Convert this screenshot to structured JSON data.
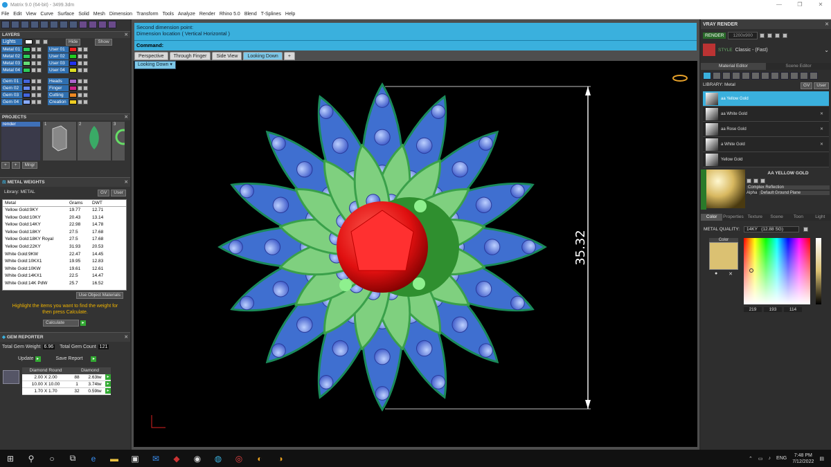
{
  "window": {
    "title": "Matrix 9.0 (64-bit) - 3499.3dm",
    "controls": [
      "—",
      "❐",
      "✕"
    ]
  },
  "menu": [
    "File",
    "Edit",
    "View",
    "Curve",
    "Surface",
    "Solid",
    "Mesh",
    "Dimension",
    "Transform",
    "Tools",
    "Analyze",
    "Render",
    "Rhino 5.0",
    "Blend",
    "T-Splines",
    "Help"
  ],
  "layers": {
    "title": "LAYERS",
    "lights": "Lights",
    "hide_label": "Hide",
    "show_label": "Show",
    "left": [
      {
        "name": "Metal 01",
        "color": "#2ecc5a"
      },
      {
        "name": "Metal 02",
        "color": "#2ecc5a"
      },
      {
        "name": "Metal 03",
        "color": "#66dd77"
      },
      {
        "name": "Metal 04",
        "color": "#2ecc5a"
      },
      {
        "name": "Gem 01",
        "color": "#4466dd"
      },
      {
        "name": "Gem 02",
        "color": "#6688ee"
      },
      {
        "name": "Gem 03",
        "color": "#4466dd"
      },
      {
        "name": "Gem 04",
        "color": "#88aaff"
      }
    ],
    "right": [
      {
        "name": "User 01",
        "color": "#ee2222"
      },
      {
        "name": "User 02",
        "color": "#22cc22"
      },
      {
        "name": "User 03",
        "color": "#2233ee"
      },
      {
        "name": "User 04",
        "color": "#dddd22"
      },
      {
        "name": "Heads",
        "color": "#aa66cc"
      },
      {
        "name": "Finger",
        "color": "#cc2288"
      },
      {
        "name": "Cutting",
        "color": "#ee8822"
      },
      {
        "name": "Creation",
        "color": "#eecc22"
      }
    ]
  },
  "projects": {
    "title": "PROJECTS",
    "item": "render",
    "thumbs": [
      "1",
      "2",
      "3"
    ],
    "mngr": "Mngr"
  },
  "metal_weights": {
    "title": "METAL WEIGHTS",
    "library_label": "Library: METAL",
    "tag_gv": "GV",
    "tag_user": "User",
    "headers": [
      "Metal",
      "Grams",
      "DWT"
    ],
    "rows": [
      [
        "Yellow Gold:9KY",
        "19.77",
        "12.71"
      ],
      [
        "Yellow Gold:10KY",
        "20.43",
        "13.14"
      ],
      [
        "Yellow Gold:14KY",
        "22.98",
        "14.78"
      ],
      [
        "Yellow Gold:18KY",
        "27.5",
        "17.68"
      ],
      [
        "Yellow Gold:18KY Royal",
        "27.5",
        "17.68"
      ],
      [
        "Yellow Gold:22KY",
        "31.93",
        "20.53"
      ],
      [
        "White Gold:9KW",
        "22.47",
        "14.45"
      ],
      [
        "White Gold:10KX1",
        "19.95",
        "12.83"
      ],
      [
        "White Gold:10KW",
        "19.61",
        "12.61"
      ],
      [
        "White Gold:14KX1",
        "22.5",
        "14.47"
      ],
      [
        "White Gold:14K PdW",
        "25.7",
        "16.52"
      ]
    ],
    "use_object_materials": "Use Object Materials",
    "hint": "Highlight the items you want to find the weight for then press Calculate.",
    "calculate": "Calculate"
  },
  "gem_reporter": {
    "title": "GEM REPORTER",
    "total_weight_label": "Total Gem Weight",
    "total_weight": "6.96",
    "total_count_label": "Total Gem Count",
    "total_count": "121",
    "update": "Update",
    "save_report": "Save Report",
    "col1": "Diamond Round",
    "col2": "Diamond",
    "rows": [
      [
        "2.00 X 2.00",
        "88",
        "2.63tw"
      ],
      [
        "10.00 X 10.00",
        "1",
        "3.74tw"
      ],
      [
        "1.70 X 1.70",
        "32",
        "0.59tw"
      ]
    ]
  },
  "command": {
    "line1": "Second dimension point:",
    "line2": "Dimension location ( Vertical  Horizontal )",
    "prompt": "Command:"
  },
  "viewport": {
    "tabs": [
      "Perspective",
      "Through Finger",
      "Side View",
      "Looking Down"
    ],
    "active_tab": 3,
    "add_tab": "+",
    "view_label": "Looking Down",
    "dimension": "35.32"
  },
  "vray": {
    "title": "VRAY RENDER",
    "render_btn": "RENDER",
    "resolution": "1200x900",
    "style_label": "STYLE",
    "style_value": "Classic - (Fast)",
    "tabs": [
      "Material Editor",
      "Scene Editor"
    ],
    "library_label": "LIBRARY: Metal",
    "tag_gv": "GV",
    "tag_user": "User",
    "materials": [
      "aa Yellow Gold",
      "aa White Gold",
      "aa Rose Gold",
      "a White Gold",
      "Yellow Gold"
    ],
    "selected_name": "AA YELLOW GOLD",
    "reflection": "Complex Reflection",
    "alpha": "Alpha",
    "ground": "Default Ground Plane",
    "subtabs": [
      "Color",
      "Properties",
      "Texture",
      "Scene",
      "Toon",
      "Light"
    ],
    "metal_quality_label": "METAL QUALITY:",
    "metal_quality": "14KY",
    "metal_quality_extra": "(12.88 SG)",
    "color_label": "Color",
    "swatch_color": "#dbc172",
    "rgb": [
      "219",
      "193",
      "114"
    ]
  },
  "taskbar": {
    "lang": "ENG",
    "time": "7:48 PM",
    "date": "7/12/2022"
  }
}
